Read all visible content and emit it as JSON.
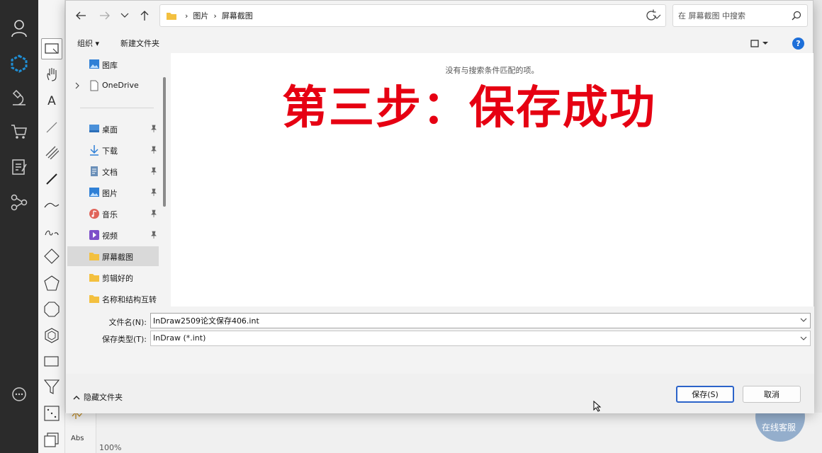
{
  "app": {
    "abs_label": "Abs",
    "zoom": "100%",
    "chat_label": "在线客服"
  },
  "dialog": {
    "breadcrumb": [
      "图片",
      "屏幕截图"
    ],
    "search_placeholder": "在 屏幕截图 中搜索",
    "organize_label": "组织 ▾",
    "new_folder_label": "新建文件夹",
    "help_label": "?",
    "nav_items": [
      {
        "label": "图库",
        "icon": "gallery-icon",
        "pinned": false
      },
      {
        "label": "OneDrive",
        "icon": "onedrive-icon",
        "pinned": false
      },
      {
        "label": "桌面",
        "icon": "desktop-icon",
        "pinned": true
      },
      {
        "label": "下载",
        "icon": "download-icon",
        "pinned": true
      },
      {
        "label": "文档",
        "icon": "document-icon",
        "pinned": true
      },
      {
        "label": "图片",
        "icon": "picture-icon",
        "pinned": true
      },
      {
        "label": "音乐",
        "icon": "music-icon",
        "pinned": true
      },
      {
        "label": "视频",
        "icon": "video-icon",
        "pinned": true
      },
      {
        "label": "屏幕截图",
        "icon": "folder-icon",
        "pinned": false,
        "selected": true
      },
      {
        "label": "剪辑好的",
        "icon": "folder-icon",
        "pinned": false
      },
      {
        "label": "名称和结构互转",
        "icon": "folder-icon",
        "pinned": false
      }
    ],
    "empty_message": "没有与搜索条件匹配的项。",
    "overlay_caption": "第三步：保存成功",
    "filename_label": "文件名(N):",
    "filename_value": "InDraw2509论文保存406.int",
    "filetype_label": "保存类型(T):",
    "filetype_value": "InDraw (*.int)",
    "hide_folders_label": "隐藏文件夹",
    "save_label": "保存(S)",
    "cancel_label": "取消"
  },
  "colors": {
    "accent": "#1e6fd9",
    "caption_red": "#e60012",
    "sidebar_dark": "#2b2b2b",
    "brand_blue": "#1f8fd6"
  }
}
